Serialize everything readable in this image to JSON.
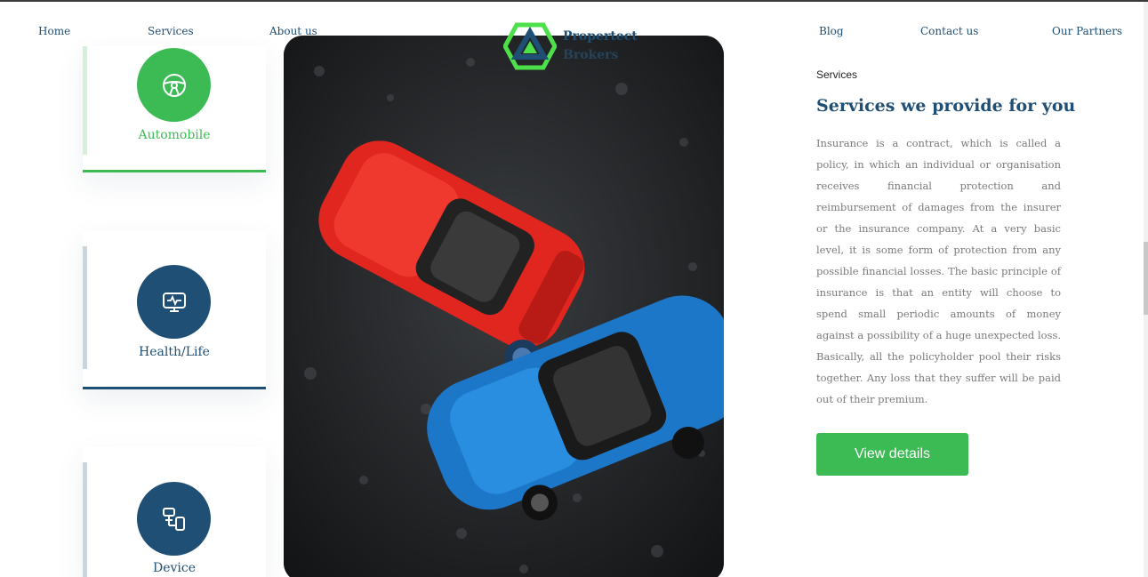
{
  "nav": {
    "home": "Home",
    "services": "Services",
    "about": "About us",
    "blog": "Blog",
    "contact": "Contact us",
    "partners": "Our Partners"
  },
  "logo": {
    "line1": "Propertect",
    "line2": "Brokers",
    "icon": "hexagon-logo-icon",
    "color_green": "#4ee04a",
    "color_blue": "#1f4f74"
  },
  "cards": [
    {
      "label": "Automobile",
      "icon": "steering-wheel-icon",
      "active": true
    },
    {
      "label": "Health/Life",
      "icon": "heart-monitor-icon",
      "active": false
    },
    {
      "label": "Device",
      "icon": "devices-icon",
      "active": false
    }
  ],
  "section": {
    "label": "Services",
    "title": "Services we provide for you",
    "body": "Insurance is a contract, which is called a policy, in which an individual or organisation receives financial protection and reimbursement of damages from the insurer or the insurance company. At a very basic level, it is some form of protection from any possible financial losses. The basic principle of insurance is that an entity will choose to spend small periodic amounts of money against a possibility of a huge unexpected loss. Basically, all the policyholder pool their risks together. Any loss that they suffer will be paid out of their premium.",
    "button": "View details"
  },
  "photo": {
    "subject": "toy-cars-crash-photo"
  },
  "colors": {
    "green": "#3cbb55",
    "navy": "#1f4f74",
    "text_gray": "#7a7a7a"
  }
}
